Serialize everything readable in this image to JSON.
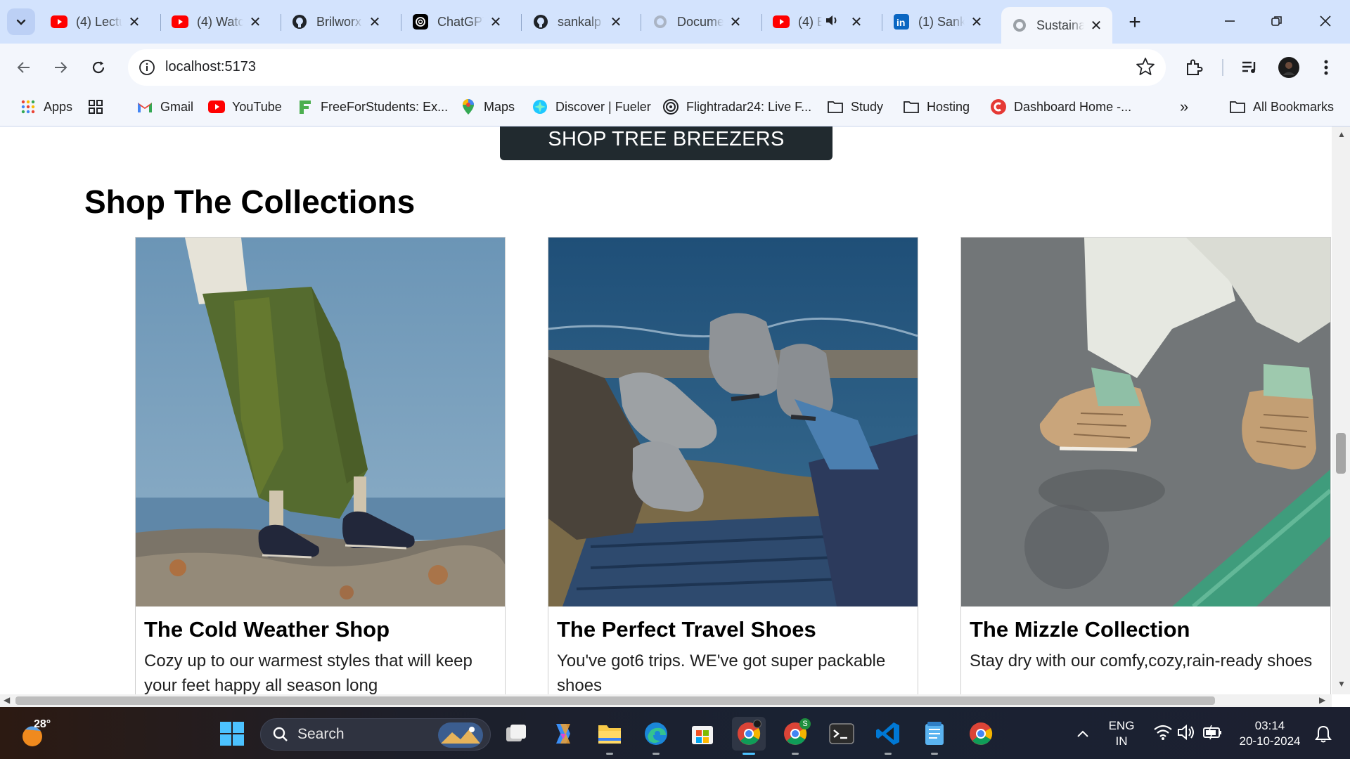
{
  "browser": {
    "tabs": [
      {
        "title": "(4) Lectu",
        "favicon": "youtube-icon",
        "active": false
      },
      {
        "title": "(4) Watc",
        "favicon": "youtube-icon",
        "active": false
      },
      {
        "title": "Brilworx",
        "favicon": "github-icon",
        "active": false
      },
      {
        "title": "ChatGPT",
        "favicon": "chatgpt-icon",
        "active": false
      },
      {
        "title": "sankalp",
        "favicon": "github-icon",
        "active": false
      },
      {
        "title": "Docume",
        "favicon": "globe-icon",
        "active": false
      },
      {
        "title": "(4) E",
        "favicon": "youtube-icon",
        "active": false,
        "audio": true
      },
      {
        "title": "(1) Sank",
        "favicon": "linkedin-icon",
        "active": false
      },
      {
        "title": "Sustaina",
        "favicon": "globe-icon",
        "active": true
      }
    ],
    "address": {
      "url": "localhost:5173"
    },
    "bookmarks": [
      {
        "label": "Apps",
        "icon": "apps-grid-icon"
      },
      {
        "label": "",
        "icon": "tab-groups-icon"
      },
      {
        "label": "Gmail",
        "icon": "gmail-icon"
      },
      {
        "label": "YouTube",
        "icon": "youtube-icon"
      },
      {
        "label": "FreeForStudents: Ex...",
        "icon": "freeforstudents-icon"
      },
      {
        "label": "Maps",
        "icon": "maps-icon"
      },
      {
        "label": "Discover | Fueler",
        "icon": "fueler-icon"
      },
      {
        "label": "Flightradar24: Live F...",
        "icon": "flightradar-icon"
      },
      {
        "label": "Study",
        "icon": "folder-icon"
      },
      {
        "label": "Hosting",
        "icon": "folder-icon"
      },
      {
        "label": "Dashboard Home -...",
        "icon": "dashboard-icon"
      }
    ],
    "bookmarks_overflow": "»",
    "all_bookmarks": "All Bookmarks"
  },
  "page": {
    "cta_label": "SHOP TREE BREEZERS",
    "section_title": "Shop The Collections",
    "collections": [
      {
        "title": "The Cold Weather Shop",
        "description": "Cozy up to our warmest styles that will keep your feet happy all season long",
        "image": "olive skirt and navy sneakers on a rocky coast"
      },
      {
        "title": "The Perfect Travel Shoes",
        "description": "You've got6 trips. WE've got super packable shoes",
        "image": "grey wool sneakers crossed on a wooden deck by the sea"
      },
      {
        "title": "The Mizzle Collection",
        "description": "Stay dry with our comfy,cozy,rain-ready shoes",
        "image": "tan boots stepping on wet pavement"
      }
    ]
  },
  "taskbar": {
    "weather": "28°",
    "search_label": "Search",
    "language": [
      "ENG",
      "IN"
    ],
    "time": "03:14",
    "date": "20-10-2024"
  },
  "colors": {
    "tabstrip": "#d3e3fd",
    "toolbar": "#f3f6fc",
    "cta_bg": "#212a2f",
    "taskbar": "#1c2030"
  }
}
